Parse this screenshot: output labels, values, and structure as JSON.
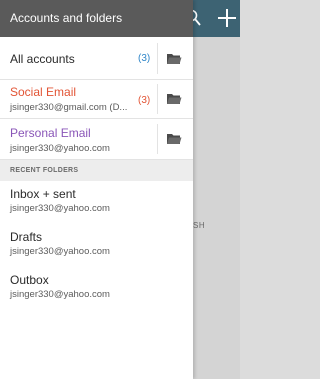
{
  "drawer": {
    "title": "Accounts and folders"
  },
  "accounts": [
    {
      "name": "All accounts",
      "email": "",
      "count": "(3)",
      "color": "#2f86c9"
    },
    {
      "name": "Social Email",
      "email": "jsinger330@gmail.com (D...",
      "count": "(3)",
      "color": "#e25435"
    },
    {
      "name": "Personal Email",
      "email": "jsinger330@yahoo.com",
      "count": "",
      "color": "#8a56b8"
    }
  ],
  "recent_section": {
    "label": "RECENT FOLDERS"
  },
  "recent_folders": [
    {
      "name": "Inbox + sent",
      "email": "jsinger330@yahoo.com"
    },
    {
      "name": "Drafts",
      "email": "jsinger330@yahoo.com"
    },
    {
      "name": "Outbox",
      "email": "jsinger330@yahoo.com"
    }
  ],
  "background": {
    "partial_text": "SH",
    "topbar_color": "#3d6373"
  },
  "icons": [
    "folder-icon",
    "search-icon",
    "plus-icon"
  ]
}
